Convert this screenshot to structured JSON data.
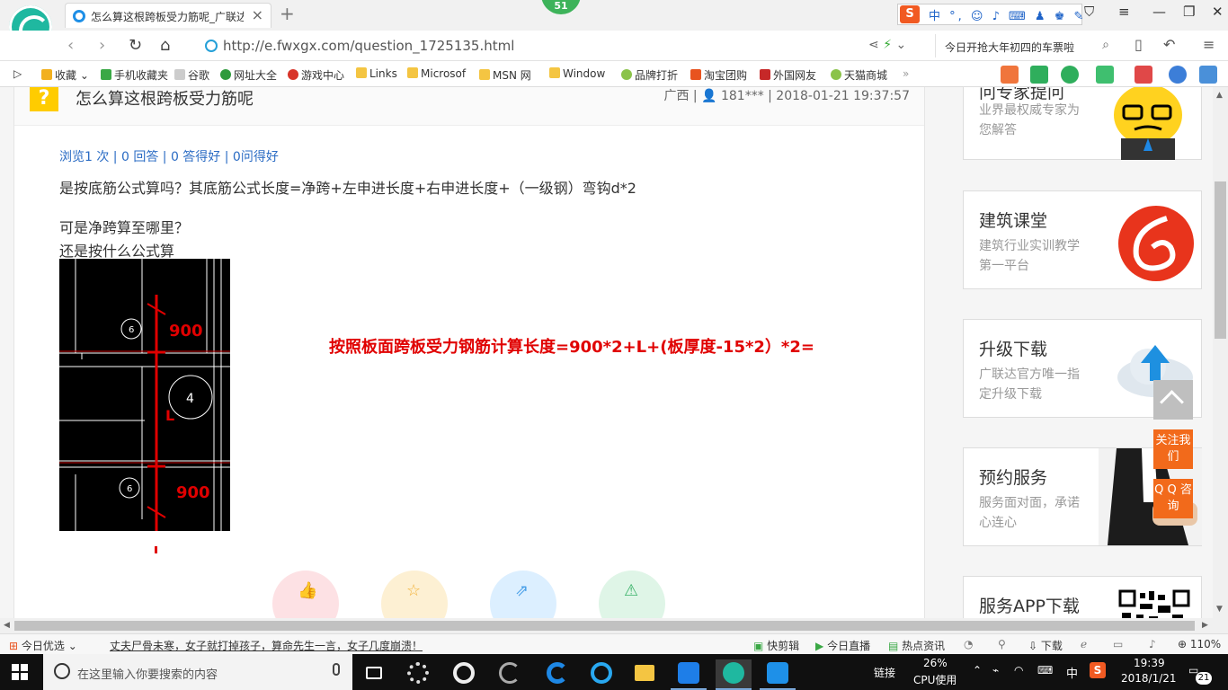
{
  "browser": {
    "tab_title": "怎么算这根跨板受力筋呢_广联达",
    "badge": "51",
    "url": "http://e.fwxgx.com/question_1725135.html",
    "search_text": "今日开抢大年初四的车票啦",
    "ime_text": "中 °, ☺ ♪ ⌨ ♟ ♚ ✎"
  },
  "favorites": [
    {
      "label": "收藏",
      "color": "#f2b01e"
    },
    {
      "label": "手机收藏夹",
      "color": "#3aa845"
    },
    {
      "label": "谷歌",
      "color": "#cccccc"
    },
    {
      "label": "网址大全",
      "color": "#2e9a3c"
    },
    {
      "label": "游戏中心",
      "color": "#d8352a"
    },
    {
      "label": "Links",
      "color": "#f4c542"
    },
    {
      "label": "Microsof",
      "color": "#f4c542"
    },
    {
      "label": "MSN 网",
      "color": "#f4c542"
    },
    {
      "label": "Window",
      "color": "#f4c542"
    },
    {
      "label": "品牌打折",
      "color": "#8bc34a"
    },
    {
      "label": "淘宝团购",
      "color": "#e8531f"
    },
    {
      "label": "外国网友",
      "color": "#c62828"
    },
    {
      "label": "天猫商城",
      "color": "#8bc34a"
    }
  ],
  "question": {
    "title": "怎么算这根跨板受力筋呢",
    "meta": "广西 | 👤 181*** | 2018-01-21 19:37:57",
    "stats": "浏览1 次 | 0 回答 | 0 答得好 | 0问得好",
    "body1": "是按底筋公式算吗？其底筋公式长度=净跨+左申进长度+右申进长度+（一级钢）弯钩d*2",
    "body2": "可是净跨算至哪里？",
    "body3": "还是按什么公式算",
    "cad_labels": {
      "top": "900",
      "mid": "L",
      "bottom": "900",
      "circle_a": "6",
      "circle_b": "4",
      "circle_c": "6"
    },
    "formula": "按照板面跨板受力钢筋计算长度=900*2+L+(板厚度-15*2）*2="
  },
  "sidebar": [
    {
      "title": "问专家提问",
      "desc": "业界最权威专家为您解答"
    },
    {
      "title": "建筑课堂",
      "desc": "建筑行业实训教学第一平台"
    },
    {
      "title": "升级下载",
      "desc": "广联达官方唯一指定升级下载"
    },
    {
      "title": "预约服务",
      "desc": "服务面对面，承诺心连心"
    },
    {
      "title": "服务APP下载",
      "desc": ""
    }
  ],
  "float_buttons": {
    "follow": "关注我们",
    "qq": "Q Q 咨询"
  },
  "statusbar": {
    "left_label": "今日优选",
    "news": "丈夫尸骨未寒，女子就打掉孩子，算命先生一言，女子几度崩溃！",
    "kuaijian": "快剪辑",
    "live": "今日直播",
    "hot": "热点资讯",
    "download": "下载",
    "zoom": "110%"
  },
  "taskbar": {
    "search_placeholder": "在这里输入你要搜索的内容",
    "link_label": "链接",
    "cpu_percent": "26%",
    "cpu_label": "CPU使用",
    "ime": "中",
    "time": "19:39",
    "date": "2018/1/21",
    "notify_count": "21"
  }
}
